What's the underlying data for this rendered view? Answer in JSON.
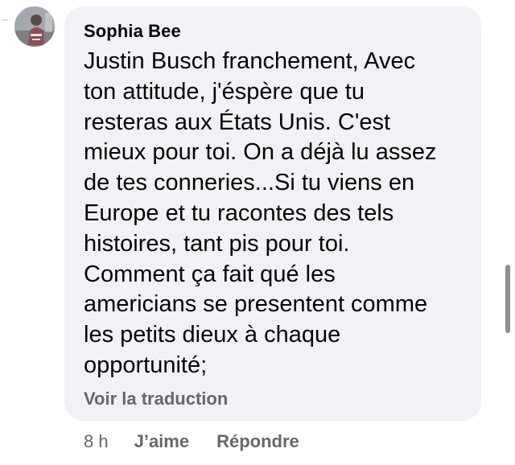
{
  "comment": {
    "author": "Sophia Bee",
    "text": "Justin Busch franchement, Avec\nton attitude, j'éspère que tu\nresteras aux États Unis. C'est\nmieux pour toi. On a déjà lu assez\nde tes conneries...Si tu viens en\nEurope et tu racontes des tels\nhistoires, tant pis pour toi.\nComment ça fait qué les\namericians  se presentent comme\nles petits dieux à chaque\nopportunité;",
    "translate_label": "Voir la traduction",
    "timestamp": "8 h",
    "like_label": "J’aime",
    "reply_label": "Répondre"
  },
  "colors": {
    "bubble_background": "#f0f2f5",
    "primary_text": "#050505",
    "secondary_text": "#65676b"
  },
  "icons": {
    "avatar": "profile-photo"
  }
}
